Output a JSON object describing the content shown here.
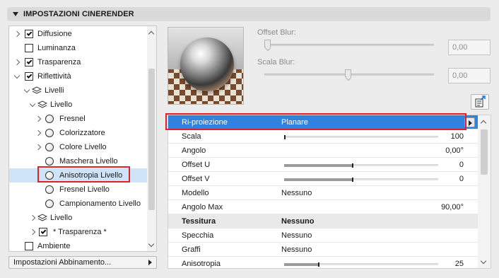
{
  "panel": {
    "title": "IMPOSTAZIONI CINERENDER"
  },
  "tree": {
    "items": [
      {
        "label": "Diffusione",
        "checked": true
      },
      {
        "label": "Luminanza",
        "checked": false
      },
      {
        "label": "Trasparenza",
        "checked": true
      },
      {
        "label": "Riflettività",
        "checked": true
      },
      {
        "label": "Livelli"
      },
      {
        "label": "Livello"
      },
      {
        "label": "Fresnel"
      },
      {
        "label": "Colorizzatore"
      },
      {
        "label": "Colore Livello"
      },
      {
        "label": "Maschera Livello"
      },
      {
        "label": "Anisotropia Livello",
        "selected": true
      },
      {
        "label": "Fresnel Livello"
      },
      {
        "label": "Campionamento Livello"
      },
      {
        "label": "Livello"
      },
      {
        "label": "* Trasparenza *",
        "checked": true
      },
      {
        "label": "Ambiente",
        "checked": false
      }
    ]
  },
  "match_settings": {
    "label": "Impostazioni Abbinamento..."
  },
  "sliders": {
    "offset_blur": {
      "label": "Offset Blur:",
      "value": "0,00"
    },
    "scala_blur": {
      "label": "Scala Blur:",
      "value": "0,00"
    }
  },
  "props": {
    "rows": [
      {
        "name": "Ri-proiezione",
        "value": "Planare"
      },
      {
        "name": "Scala",
        "value": "100",
        "fill": 0.01
      },
      {
        "name": "Angolo",
        "value": "0,00°"
      },
      {
        "name": "Offset U",
        "value": "0",
        "fill": 0.5
      },
      {
        "name": "Offset V",
        "value": "0",
        "fill": 0.5
      },
      {
        "name": "Modello",
        "value": "Nessuno"
      },
      {
        "name": "Angolo Max",
        "value": "90,00°"
      },
      {
        "name": "Tessitura",
        "value": "Nessuno"
      },
      {
        "name": "Specchia",
        "value": "Nessuno"
      },
      {
        "name": "Graffi",
        "value": "Nessuno"
      },
      {
        "name": "Anisotropia",
        "value": "25",
        "fill": 0.25
      }
    ]
  },
  "colors": {
    "selected_row": "#2f82df",
    "highlight": "#e0202a",
    "tree_selected": "#cfe4f7"
  }
}
